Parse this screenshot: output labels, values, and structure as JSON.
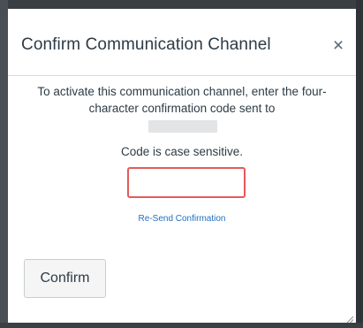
{
  "dialog": {
    "title": "Confirm Communication Channel",
    "close_glyph": "×",
    "close_icon": "close-icon"
  },
  "body": {
    "instructions": "To activate this communication channel, enter the four-character confirmation code sent to",
    "case_note": "Code is case sensitive.",
    "code_input": {
      "value": "",
      "border_color": "#e55a5a"
    },
    "resend_label": "Re-Send Confirmation",
    "link_color": "#1e6fc2"
  },
  "footer": {
    "confirm_label": "Confirm"
  },
  "icons": {
    "resize": "resize-grip-icon"
  }
}
